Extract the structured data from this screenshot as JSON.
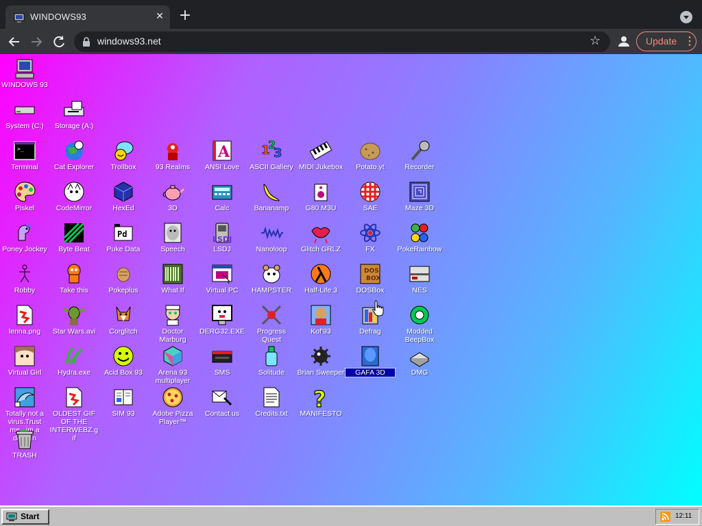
{
  "browser": {
    "tab_title": "WINDOWS93",
    "tab_close": "✕",
    "new_tab": "+",
    "url": "windows93.net",
    "update_label": "Update",
    "update_menu": "⋮"
  },
  "desktop": {
    "icons": [
      {
        "label": "WINDOWS 93",
        "icon": "computer-icon"
      },
      {
        "label": "System (C:)",
        "icon": "drive-icon"
      },
      {
        "label": "Storage (A:)",
        "icon": "floppy-drive-icon"
      },
      {
        "label": "Terminal",
        "icon": "terminal-icon"
      },
      {
        "label": "Cat Explorer",
        "icon": "cat-globe-icon"
      },
      {
        "label": "Trollbox",
        "icon": "chat-bubble-icon"
      },
      {
        "label": "93 Realms",
        "icon": "realms-icon"
      },
      {
        "label": "ANSI Love",
        "icon": "ansi-icon"
      },
      {
        "label": "ASCII Gallery",
        "icon": "numbers-icon"
      },
      {
        "label": "MIDI Jukebox",
        "icon": "piano-icon"
      },
      {
        "label": "Potato.yt",
        "icon": "potato-icon"
      },
      {
        "label": "Recorder",
        "icon": "microphone-icon"
      },
      {
        "label": "Piskel",
        "icon": "palette-icon"
      },
      {
        "label": "CodeMirror",
        "icon": "code-cat-icon"
      },
      {
        "label": "HexEd",
        "icon": "cube-icon"
      },
      {
        "label": "3D",
        "icon": "teapot-icon"
      },
      {
        "label": "Calc",
        "icon": "calculator-icon"
      },
      {
        "label": "Bananamp",
        "icon": "banana-icon"
      },
      {
        "label": "G80.M3U",
        "icon": "speaker-icon"
      },
      {
        "label": "SAE",
        "icon": "amiga-ball-icon"
      },
      {
        "label": "Maze 3D",
        "icon": "maze-icon"
      },
      {
        "label": "Poney Jockey",
        "icon": "pony-icon"
      },
      {
        "label": "Byte Beat",
        "icon": "bytebeat-icon"
      },
      {
        "label": "Puke Data",
        "icon": "pd-icon"
      },
      {
        "label": "Speech",
        "icon": "face-icon"
      },
      {
        "label": "LSDJ",
        "icon": "gameboy-icon"
      },
      {
        "label": "Nanoloop",
        "icon": "waveform-icon"
      },
      {
        "label": "Glitch GRLZ",
        "icon": "lips-icon"
      },
      {
        "label": "FX",
        "icon": "atom-icon"
      },
      {
        "label": "PokeRainbow",
        "icon": "pokemon-icon"
      },
      {
        "label": "Robby",
        "icon": "stick-figure-icon"
      },
      {
        "label": "Take this",
        "icon": "ghost-man-icon"
      },
      {
        "label": "Pokeplus",
        "icon": "hand-icon"
      },
      {
        "label": "What If",
        "icon": "barcode-icon"
      },
      {
        "label": "Virtual PC",
        "icon": "window-icon"
      },
      {
        "label": "HAMPSTER",
        "icon": "hamster-icon"
      },
      {
        "label": "Half-Life 3",
        "icon": "lambda-icon"
      },
      {
        "label": "DOSBox",
        "icon": "dosbox-icon"
      },
      {
        "label": "NES",
        "icon": "nes-icon"
      },
      {
        "label": "lenna.png",
        "icon": "image-file-icon"
      },
      {
        "label": "Star Wars.avi",
        "icon": "yoda-icon"
      },
      {
        "label": "Corglitch",
        "icon": "corgi-icon"
      },
      {
        "label": "Doctor Marburg",
        "icon": "doctor-icon"
      },
      {
        "label": "DERG32.EXE",
        "icon": "monitor-face-icon"
      },
      {
        "label": "Progress Quest",
        "icon": "swords-icon"
      },
      {
        "label": "Kof'93",
        "icon": "fighter-icon"
      },
      {
        "label": "Defrag",
        "icon": "defrag-icon"
      },
      {
        "label": "Modded BeepBox",
        "icon": "ring-icon"
      },
      {
        "label": "Virtual Girl",
        "icon": "girl-face-icon"
      },
      {
        "label": "Hydra.exe",
        "icon": "hydra-icon"
      },
      {
        "label": "Acid Box 93",
        "icon": "smiley-icon"
      },
      {
        "label": "Arena 93 multiplayer",
        "icon": "arena-cube-icon"
      },
      {
        "label": "SMS",
        "icon": "console-icon"
      },
      {
        "label": "Solitude",
        "icon": "bottle-icon"
      },
      {
        "label": "Brian Sweeper",
        "icon": "mine-icon"
      },
      {
        "label": "GAFA 3D",
        "icon": "blue-head-icon"
      },
      {
        "label": "DMG",
        "icon": "dmg-icon"
      },
      {
        "label": "Totally not a virus.Trust me...im a dolphin",
        "icon": "dolphin-icon"
      },
      {
        "label": "OLDEST GIF OF THE INTERWEBZ.gif",
        "icon": "gif-file-icon"
      },
      {
        "label": "SIM 93",
        "icon": "book-icon"
      },
      {
        "label": "Adobe Pizza Player™",
        "icon": "pizza-icon"
      },
      {
        "label": "Contact us",
        "icon": "letter-icon"
      },
      {
        "label": "Credits.txt",
        "icon": "text-file-icon"
      },
      {
        "label": "MANIFESTO",
        "icon": "question-icon"
      },
      {
        "label": "TRASH",
        "icon": "trash-icon"
      }
    ]
  },
  "taskbar": {
    "start_label": "Start",
    "clock": "12:11",
    "tray_icon": "rss-icon"
  },
  "colors": {
    "gradient_start": "#ff00ff",
    "gradient_end": "#00ffff",
    "taskbar": "#c0c0c0",
    "selection": "#0000aa",
    "update_accent": "#f28b82"
  }
}
